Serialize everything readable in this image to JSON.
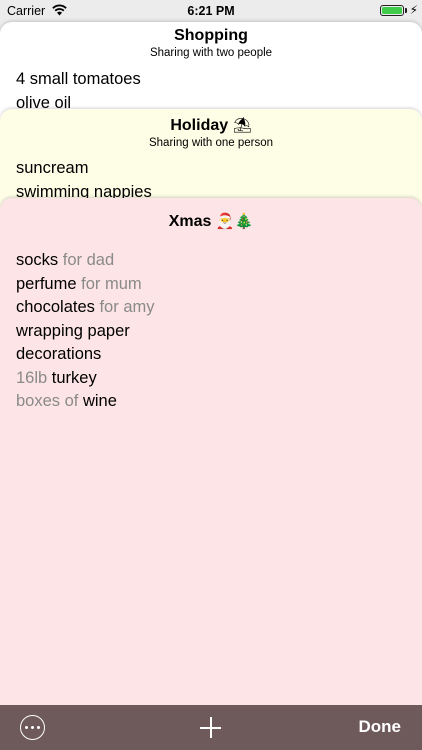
{
  "status_bar": {
    "carrier": "Carrier",
    "time": "6:21 PM",
    "battery_level": 1.0,
    "battery_color": "#3fcc4a",
    "icons": [
      "wifi-icon",
      "battery-icon",
      "charging-bolt-icon"
    ]
  },
  "lists": [
    {
      "title": "Shopping",
      "subtitle": "Sharing with two people",
      "background": "#ffffff",
      "items": [
        {
          "text": "4 small tomatoes"
        },
        {
          "text": "olive oil"
        }
      ]
    },
    {
      "title": "Holiday",
      "title_icon": "⛱",
      "subtitle": "Sharing with one person",
      "background": "#fefde6",
      "items": [
        {
          "text": "suncream"
        },
        {
          "text": "swimming nappies"
        }
      ]
    },
    {
      "title": "Xmas",
      "title_icon": "🎅🎄",
      "background": "#fde4e6",
      "items": [
        {
          "main": "socks",
          "note": " for dad"
        },
        {
          "main": "perfume",
          "note": " for mum"
        },
        {
          "main": "chocolates",
          "note": " for amy"
        },
        {
          "text": "wrapping paper"
        },
        {
          "text": "decorations"
        },
        {
          "prefix": "16lb ",
          "main": "turkey"
        },
        {
          "prefix": "boxes of ",
          "main": "wine"
        }
      ]
    }
  ],
  "toolbar": {
    "background": "#6e5a5a",
    "more_icon": "ellipsis-circle-icon",
    "add_icon": "plus-icon",
    "done_label": "Done"
  }
}
